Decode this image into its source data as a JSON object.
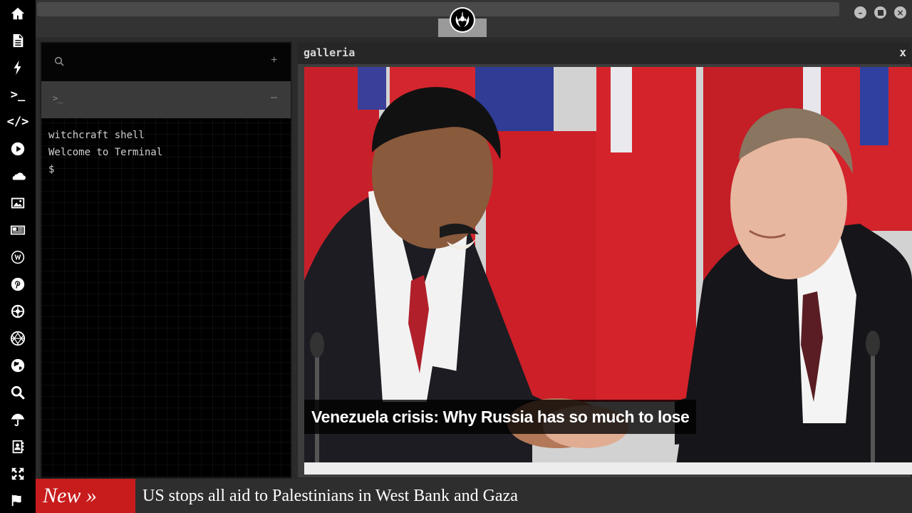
{
  "dock": {
    "items": [
      {
        "icon": "home-icon"
      },
      {
        "icon": "document-icon"
      },
      {
        "icon": "lightning-icon"
      },
      {
        "icon": "terminal-icon",
        "glyph": ">_"
      },
      {
        "icon": "code-icon",
        "glyph": "</>"
      },
      {
        "icon": "play-icon"
      },
      {
        "icon": "cloud-icon"
      },
      {
        "icon": "image-icon"
      },
      {
        "icon": "newspaper-icon"
      },
      {
        "icon": "wordpress-icon"
      },
      {
        "icon": "pinterest-icon"
      },
      {
        "icon": "empire-icon"
      },
      {
        "icon": "mesh-globe-icon"
      },
      {
        "icon": "globe-icon"
      },
      {
        "icon": "search-icon"
      },
      {
        "icon": "umbrella-icon"
      },
      {
        "icon": "contacts-icon"
      },
      {
        "icon": "expand-icon"
      },
      {
        "icon": "flag-icon"
      }
    ]
  },
  "topbar": {
    "logo_icon": "rebel-alliance-icon",
    "window_controls": [
      "minimize-icon",
      "maximize-icon",
      "close-icon"
    ]
  },
  "terminal": {
    "search_icon": "search-icon",
    "add_label": "+",
    "prompt_symbol": ">_",
    "collapse_label": "–",
    "output": [
      "witchcraft shell",
      "Welcome to Terminal",
      "$"
    ]
  },
  "gallery": {
    "title": "galleria",
    "close_label": "x",
    "caption": "Venezuela crisis: Why Russia has so much to lose"
  },
  "ticker": {
    "label": "New »",
    "headline": "US stops all aid to Palestinians in West Bank and Gaza"
  },
  "colors": {
    "dock_bg": "#000000",
    "ticker_label_bg": "#c81c1c",
    "panel_bg": "#2b2b2b"
  }
}
